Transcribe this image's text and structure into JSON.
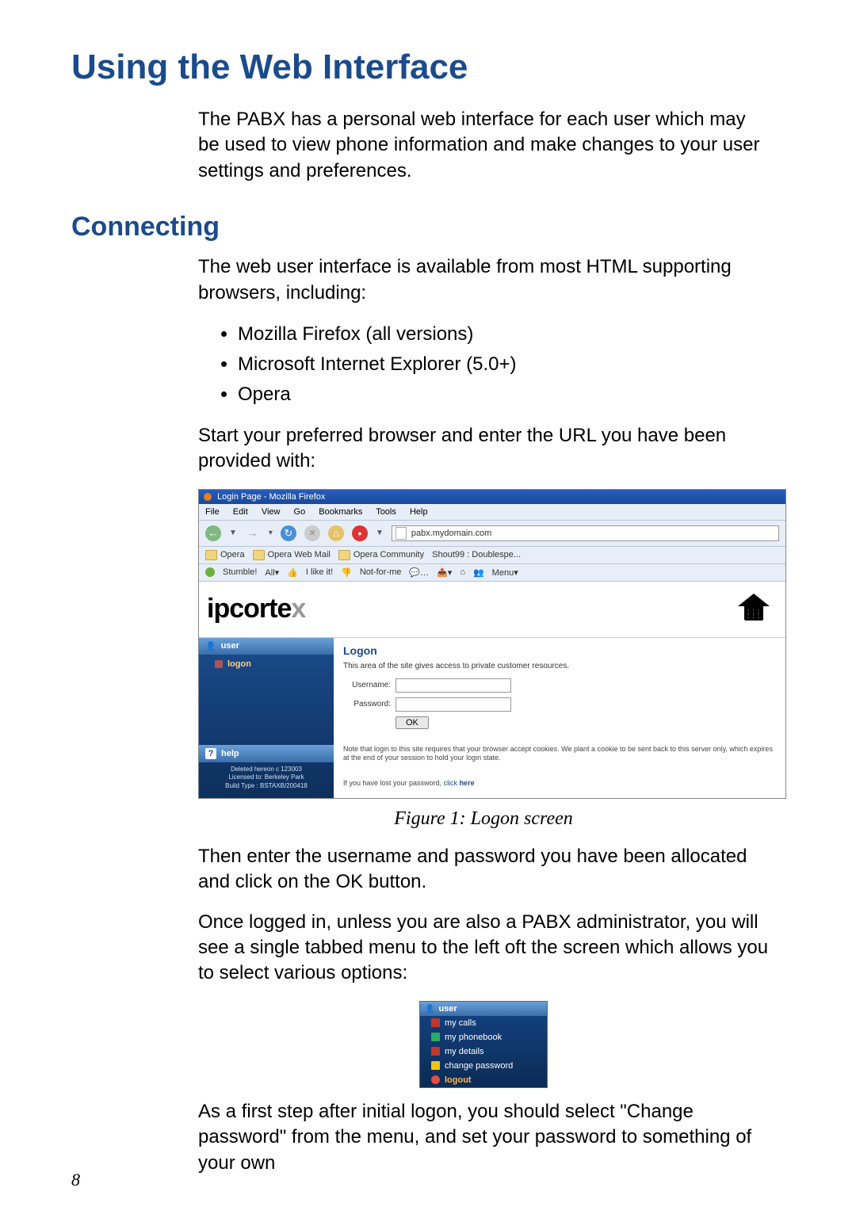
{
  "page_number": "8",
  "h1": "Using the Web Interface",
  "intro_para": "The PABX has a personal web interface for each user which may be used to view phone information and make changes to your user settings and preferences.",
  "h2_connecting": "Connecting",
  "connecting_para1": "The web user interface is available from most HTML supporting browsers, including:",
  "browsers": [
    "Mozilla Firefox (all versions)",
    "Microsoft Internet Explorer (5.0+)",
    "Opera"
  ],
  "connecting_para2": "Start your preferred browser and enter the URL you have been provided with:",
  "figure1_caption": "Figure 1: Logon screen",
  "post_fig1_para1": "Then enter the username and password you have been allocated and click on the OK button.",
  "post_fig1_para2": "Once logged in, unless you are also a PABX administrator, you will see a single tabbed menu to the left oft the screen which allows you to select various options:",
  "post_fig2_para": "As a first step after initial logon, you should select \"Change password\" from the menu, and set your password to something of your own",
  "figure1": {
    "window_title": "Login Page - Mozilla Firefox",
    "menubar": [
      "File",
      "Edit",
      "View",
      "Go",
      "Bookmarks",
      "Tools",
      "Help"
    ],
    "url": "pabx.mydomain.com",
    "bookmarks": [
      "Opera",
      "Opera Web Mail",
      "Opera Community",
      "Shout99 : Doublespe..."
    ],
    "stumble": {
      "label": "Stumble!",
      "all": "All",
      "like": "I like it!",
      "not": "Not-for-me",
      "menu": "Menu"
    },
    "logo_text": "ipcortex",
    "sidebar": {
      "user_head": "user",
      "logon_item": "logon",
      "help_head": "help",
      "footer_line1": "Deleted hereon c 123003",
      "footer_line2": "Licensed to: Berkeley Park",
      "footer_line3": "Build Type : BSTAXB/200418"
    },
    "main": {
      "heading": "Logon",
      "intro": "This area of the site gives access to private customer resources.",
      "username_label": "Username:",
      "password_label": "Password:",
      "ok": "OK",
      "note1": "Note that login to this site requires that your browser accept cookies. We plant a cookie to be sent back to this server only, which expires at the end of your session to hold your login state.",
      "note2_prefix": "If you have lost your password, ",
      "note2_link": "click ",
      "note2_here": "here"
    }
  },
  "figure2": {
    "head": "user",
    "items": [
      "my calls",
      "my phonebook",
      "my details",
      "change password",
      "logout"
    ]
  }
}
